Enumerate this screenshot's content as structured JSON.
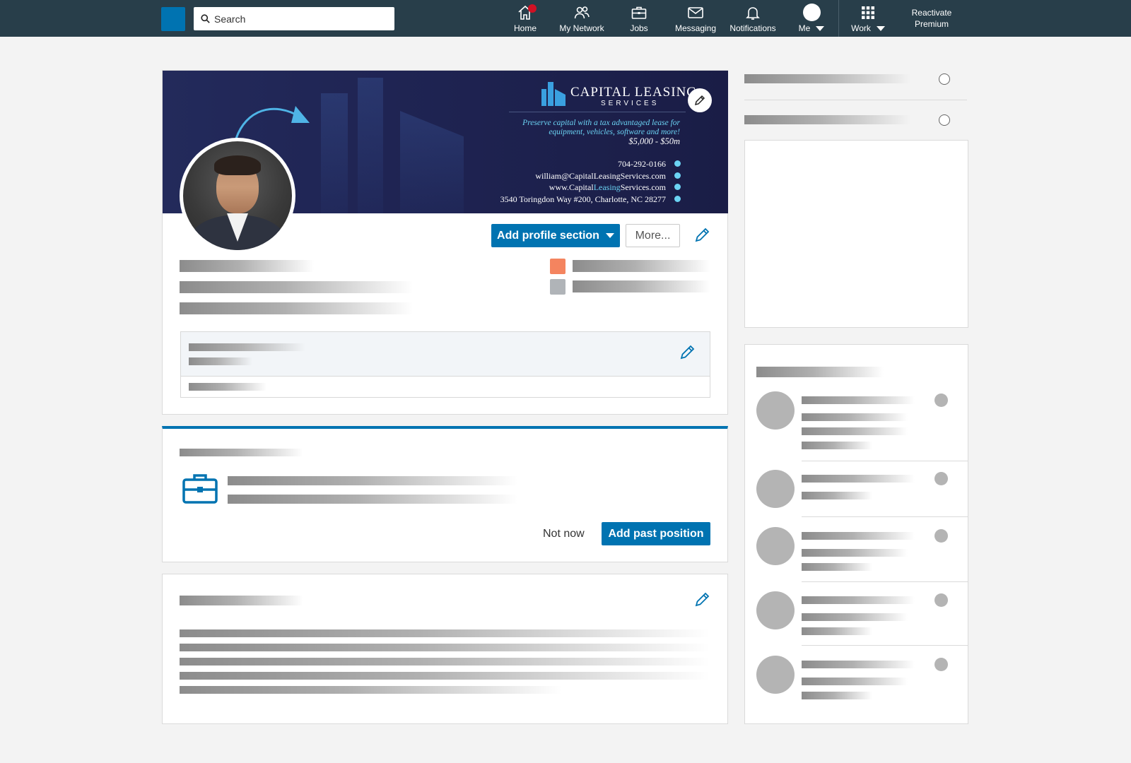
{
  "nav": {
    "search_placeholder": "Search",
    "items": [
      {
        "label": "Home",
        "icon": "home-icon",
        "has_badge": true
      },
      {
        "label": "My Network",
        "icon": "people-icon"
      },
      {
        "label": "Jobs",
        "icon": "briefcase-icon"
      },
      {
        "label": "Messaging",
        "icon": "envelope-icon"
      },
      {
        "label": "Notifications",
        "icon": "bell-icon"
      },
      {
        "label": "Me",
        "icon": "avatar"
      },
      {
        "label": "Work",
        "icon": "grid-icon"
      }
    ],
    "premium_line1": "Reactivate",
    "premium_line2": "Premium"
  },
  "banner": {
    "brand_name": "CAPITAL LEASING",
    "brand_sub": "SERVICES",
    "tagline_1": "Preserve capital with a tax advantaged lease for",
    "tagline_2": "equipment, vehicles, software and more!",
    "price": "$5,000 - $50m",
    "phone": "704-292-0166",
    "email": "william@CapitalLeasingServices.com",
    "web_prefix": "www.Capital",
    "web_highlight": "Leasing",
    "web_suffix": "Services.com",
    "address": "3540 Toringdon Way #200, Charlotte, NC 28277"
  },
  "profile": {
    "add_section_label": "Add profile section",
    "more_label": "More...",
    "square_colors": [
      "#f4845f",
      "#b0b4b8"
    ]
  },
  "experience_prompt": {
    "not_now_label": "Not now",
    "add_position_label": "Add past position"
  },
  "colors": {
    "nav_bg": "#283e4a",
    "brand_blue": "#0073b1",
    "badge_red": "#d11124"
  }
}
